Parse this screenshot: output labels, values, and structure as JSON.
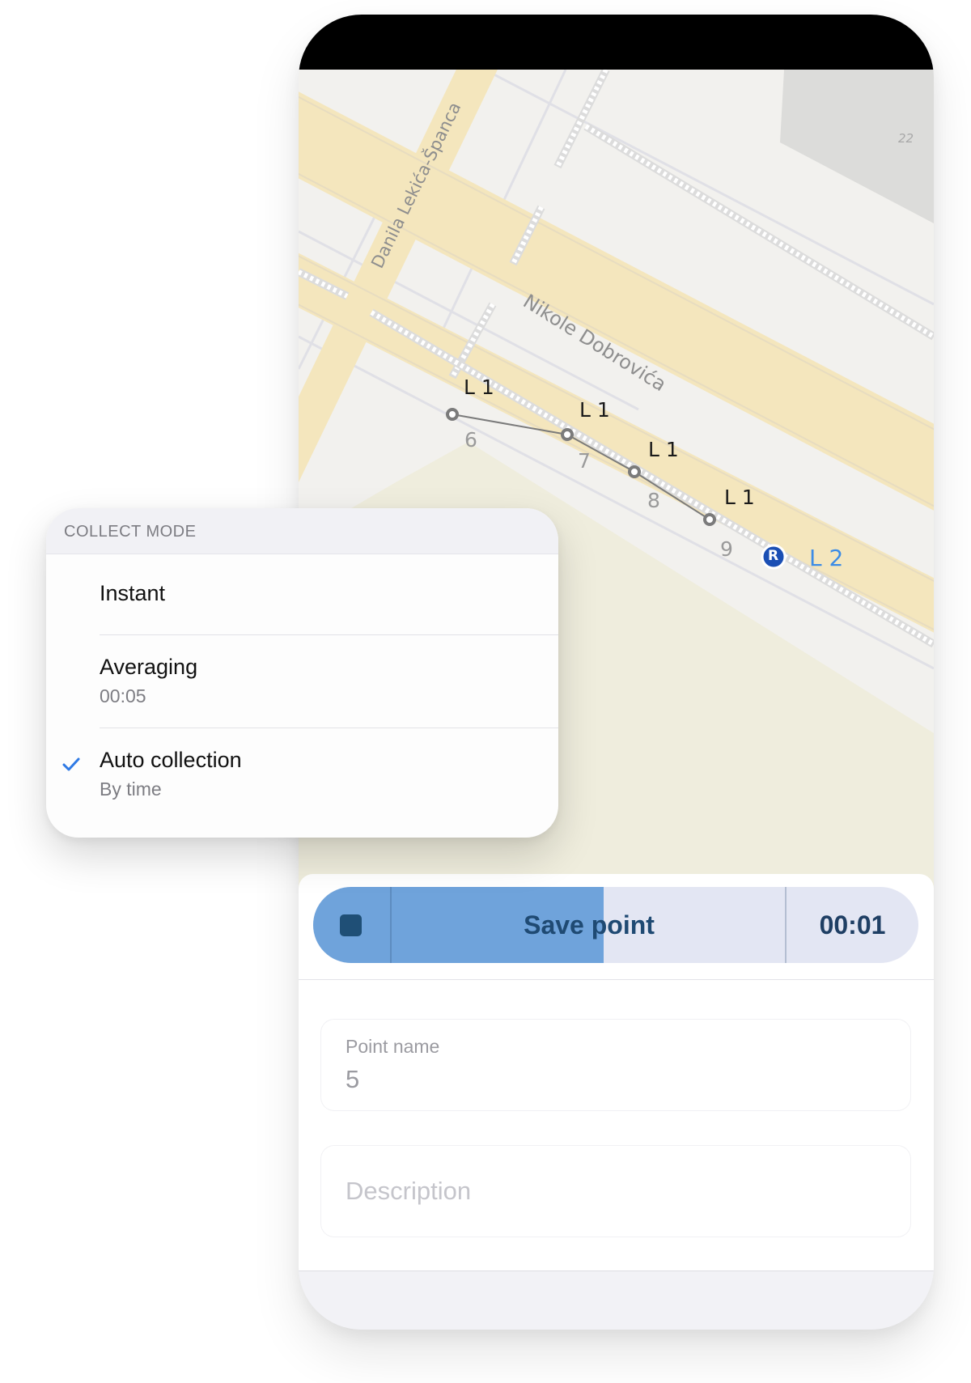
{
  "map": {
    "streets": [
      "Danila Lekića-Španca",
      "Nikole Dobrovića"
    ],
    "building_number": "22",
    "points": [
      {
        "layer": "L 1",
        "number": "6"
      },
      {
        "layer": "L 1",
        "number": "7"
      },
      {
        "layer": "L 1",
        "number": "8"
      },
      {
        "layer": "L 1",
        "number": "9"
      }
    ],
    "current": {
      "marker": "R",
      "layer": "L 2"
    },
    "colors": {
      "road": "#f4e6bd",
      "land": "#f2f1ee",
      "park": "#efeedc",
      "marker": "#1b4fb4",
      "current_layer_label": "#3c8ce6"
    }
  },
  "collect_mode": {
    "header": "COLLECT MODE",
    "options": [
      {
        "title": "Instant",
        "subtitle": "",
        "selected": false
      },
      {
        "title": "Averaging",
        "subtitle": "00:05",
        "selected": false
      },
      {
        "title": "Auto collection",
        "subtitle": "By time",
        "selected": true
      }
    ],
    "check_icon": "checkmark-icon",
    "accent": "#2f7ae5"
  },
  "save_bar": {
    "label": "Save point",
    "timer": "00:01",
    "progress": 0.48,
    "stop_icon": "stop-icon",
    "colors": {
      "fill": "#6fa3db",
      "track": "#e3e6f3",
      "text": "#1f4a73"
    }
  },
  "form": {
    "point_name": {
      "label": "Point name",
      "value": "5"
    },
    "description": {
      "placeholder": "Description"
    }
  }
}
